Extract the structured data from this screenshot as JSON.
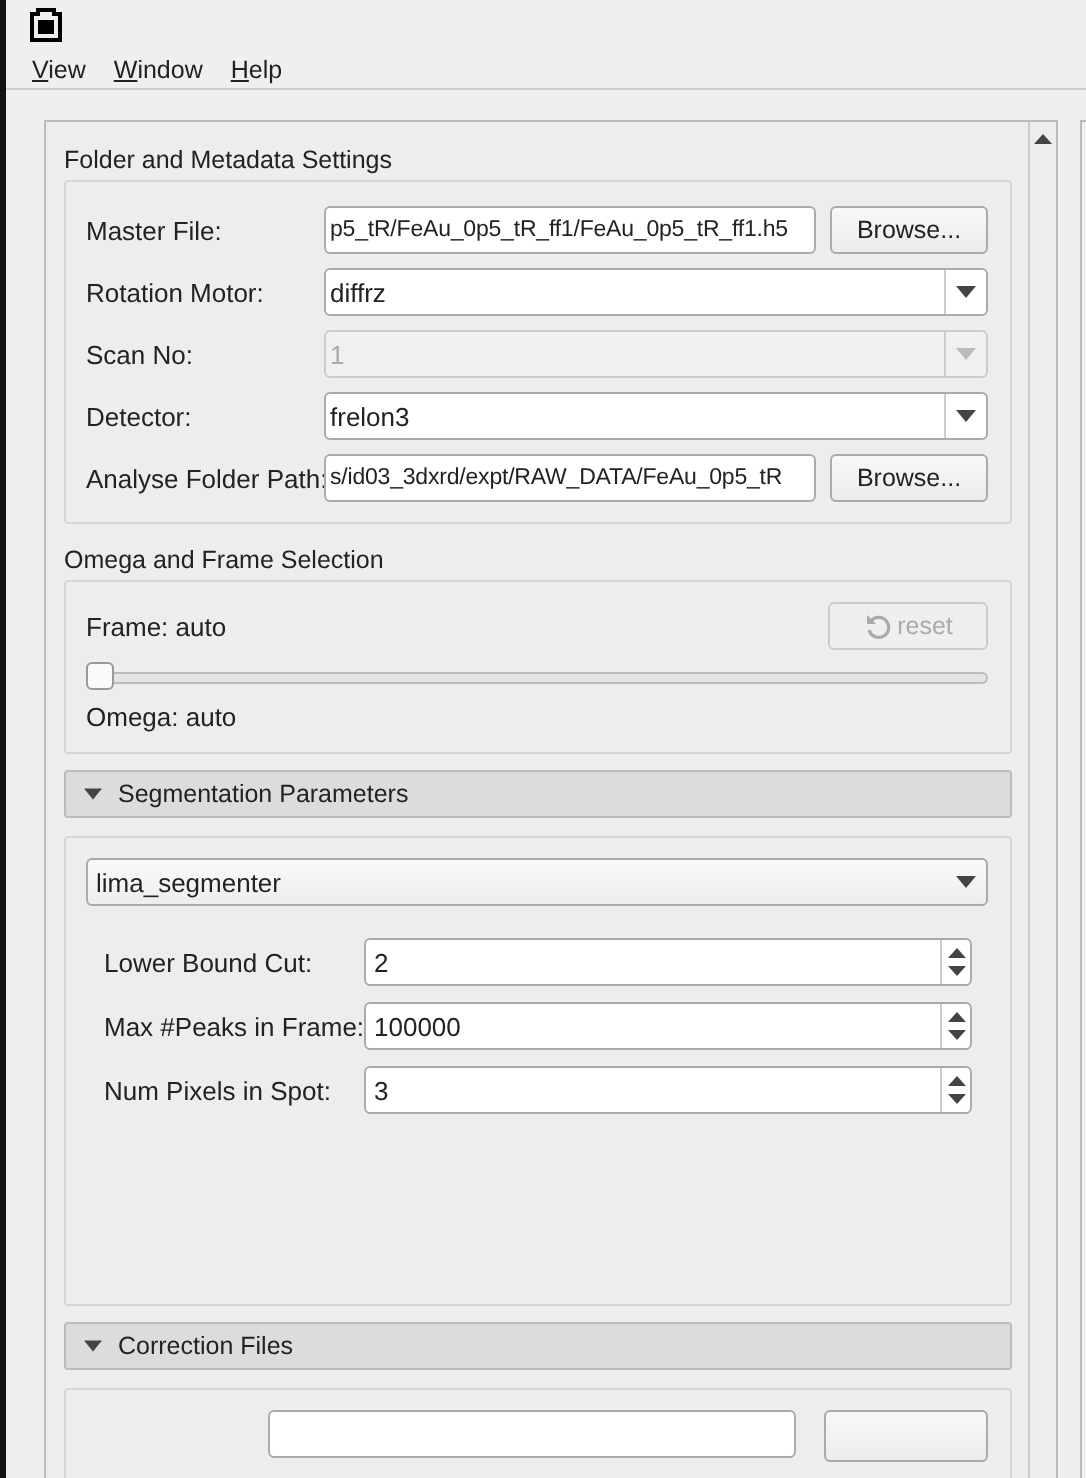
{
  "menu": [
    {
      "label": "View"
    },
    {
      "label": "Window"
    },
    {
      "label": "Help"
    }
  ],
  "folder_group": {
    "title": "Folder and Metadata Settings",
    "rows": [
      {
        "kind": "file",
        "label": "Master File:",
        "value": "p5_tR/FeAu_0p5_tR_ff1/FeAu_0p5_tR_ff1.h5",
        "button": "Browse..."
      },
      {
        "kind": "combo",
        "label": "Rotation Motor:",
        "value": "diffrz",
        "disabled": false
      },
      {
        "kind": "combo",
        "label": "Scan No:",
        "value": "1",
        "disabled": true
      },
      {
        "kind": "combo",
        "label": "Detector:",
        "value": "frelon3",
        "disabled": false
      },
      {
        "kind": "file",
        "label": "Analyse Folder Path:",
        "value": "s/id03_3dxrd/expt/RAW_DATA/FeAu_0p5_tR",
        "button": "Browse..."
      }
    ]
  },
  "omega_group": {
    "title": "Omega and Frame Selection",
    "frame_label": "Frame: auto",
    "reset_button": {
      "label": "reset",
      "disabled": true
    },
    "slider": {
      "level": 0
    },
    "omega_label": "Omega: auto"
  },
  "segmentation": {
    "title": "Segmentation Parameters",
    "expanded": true,
    "method": "lima_segmenter",
    "params": [
      {
        "label": "Lower Bound Cut:",
        "value": "2"
      },
      {
        "label": "Max #Peaks in Frame:",
        "value": "100000"
      },
      {
        "label": "Num Pixels in Spot:",
        "value": "3"
      }
    ]
  },
  "correction": {
    "title": "Correction Files",
    "expanded": true
  }
}
